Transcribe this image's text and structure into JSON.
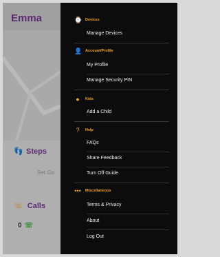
{
  "app": {
    "child_name": "Emma",
    "steps_label": "Steps",
    "set_goal_text": "Set Go",
    "calls_label": "Calls",
    "calls_count": "0"
  },
  "drawer": {
    "sections": [
      {
        "title": "Devices",
        "icon": "watch-icon",
        "items": [
          "Manage Devices"
        ]
      },
      {
        "title": "Account/Profile",
        "icon": "account-icon",
        "items": [
          "My Profile",
          "Manage Security PIN"
        ]
      },
      {
        "title": "Kids",
        "icon": "kids-icon",
        "items": [
          "Add a Child"
        ]
      },
      {
        "title": "Help",
        "icon": "help-icon",
        "items": [
          "FAQs",
          "Share Feedback",
          "Turn Off Guide"
        ]
      },
      {
        "title": "Miscellaneous",
        "icon": "more-icon",
        "items": [
          "Terms & Privacy",
          "About",
          "Log Out"
        ]
      }
    ]
  },
  "colors": {
    "accent": "#f1a51e",
    "brand": "#6b2f83",
    "drawer_bg": "#0c0c0c"
  }
}
